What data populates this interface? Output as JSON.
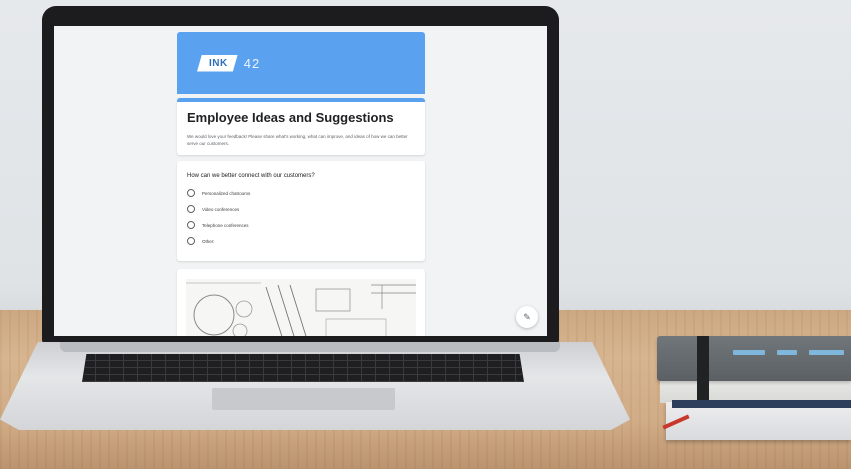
{
  "form": {
    "logo_text": "INK",
    "logo_number": "42",
    "title": "Employee Ideas and Suggestions",
    "description": "We would love your feedback! Please share what's working, what can improve, and ideas of how we can better serve our customers.",
    "question": "How can we better connect with our customers?",
    "options": [
      {
        "label": "Personalized chatrooms"
      },
      {
        "label": "Video conferences"
      },
      {
        "label": "Telephone conferences"
      },
      {
        "label": "Other:"
      }
    ]
  },
  "colors": {
    "header_blue": "#5aa1ef",
    "laptop_bezel": "#1c1c1e",
    "desk_wood": "#d6b38d"
  },
  "icons": {
    "fab": "pencil-icon"
  }
}
